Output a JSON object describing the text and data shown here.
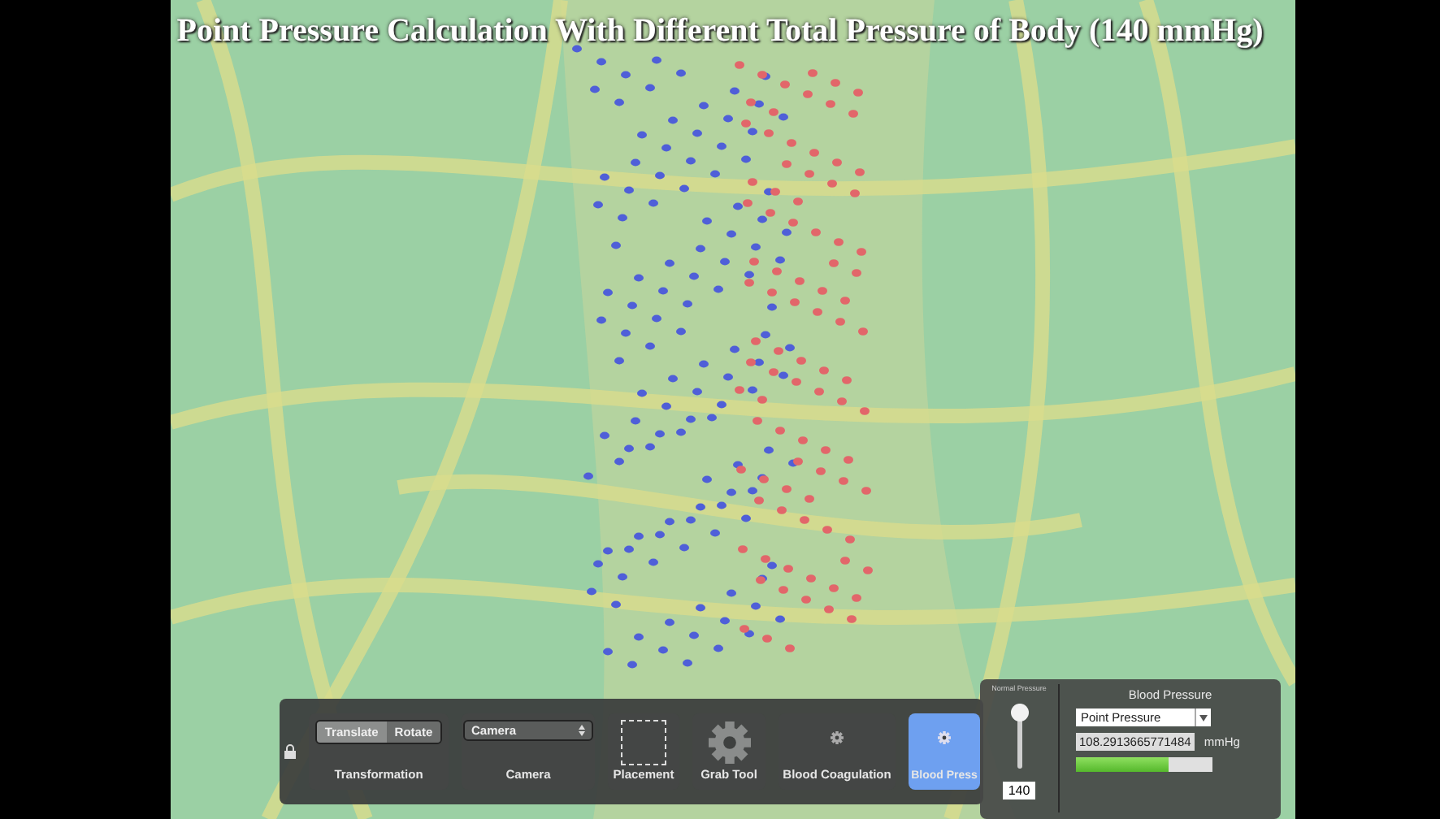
{
  "title": "Point Pressure Calculation With Different Total Pressure of Body (140 mmHg)",
  "toolbar": {
    "locked": true,
    "cards": [
      {
        "kind": "segmented",
        "label": "Transformation",
        "selected": false,
        "options": [
          {
            "label": "Translate",
            "selected": true
          },
          {
            "label": "Rotate",
            "selected": false
          }
        ]
      },
      {
        "kind": "dropdown",
        "label": "Camera",
        "selected": false,
        "value": "Camera"
      },
      {
        "kind": "placeholder",
        "label": "Placement",
        "selected": false
      },
      {
        "kind": "gear",
        "label": "Grab Tool",
        "selected": false
      },
      {
        "kind": "small-gear",
        "label": "Blood Coagulation",
        "selected": false
      },
      {
        "kind": "small-gear",
        "label": "Blood Press",
        "selected": true
      }
    ]
  },
  "pressure_panel": {
    "slider_label": "Normal Pressure",
    "slider": {
      "level": 0.92
    },
    "slider_value": "140",
    "title": "Blood Pressure",
    "mode": "Point Pressure",
    "reading": "108.2913665771484",
    "unit": "mmHg",
    "gauge": {
      "level": 0.68
    }
  }
}
